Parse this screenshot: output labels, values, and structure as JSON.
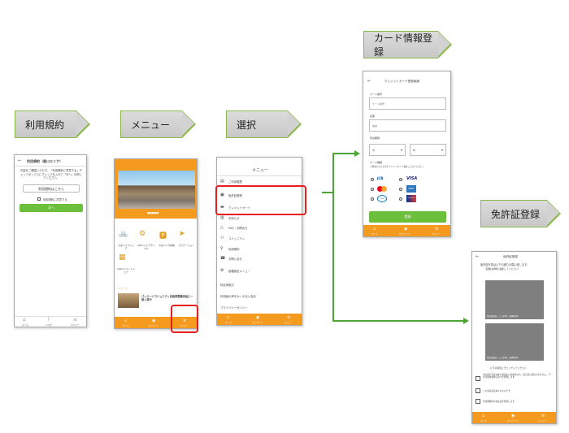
{
  "steps": {
    "terms": "利用規約",
    "menu": "メニュー",
    "select": "選択",
    "card": "カード情報登録",
    "license": "免許証登録"
  },
  "terms_screen": {
    "title": "利用規約（香川エリア）",
    "intro": "内容をご確認いただき、「利用規約に同意する」チェックボックスにチェックを入れて「次へ」を押してください。",
    "view_button": "利用規約はこちら",
    "agree_label": "利用規約に同意する",
    "next_button": "次へ",
    "nav": [
      "ホーム",
      "ヘルプ",
      "メニュー"
    ]
  },
  "menu_screen": {
    "slider_label": "■■■■■",
    "items": [
      "ちばバイクシェア",
      "OpEnシェアサイクル",
      "ちばバイク駐輪",
      "ナビゲーション",
      "OpEnイベントシェア"
    ],
    "news_header": "ニュース",
    "news_text": "パッケージコミュニティ自転車整備用品に一部入荷中",
    "nav": [
      "ホーム",
      "マイページ",
      "メニュー"
    ]
  },
  "select_screen": {
    "title": "メニュー",
    "items": [
      "ご利用履歴",
      "免許証登録",
      "クレジットカード",
      "お知らせ",
      "FAQ・お問合せ",
      "コミュニティ",
      "利用規約",
      "お問い合せ",
      "各種設定メニュー",
      "特定商取引",
      "利用者の声をかくれない会社",
      "プライバシーポリシー"
    ],
    "nav": [
      "ホーム",
      "マイページ",
      "メニュー"
    ]
  },
  "card_screen": {
    "title": "クレジットカード登録画面",
    "card_number_label": "カード番号",
    "card_number_placeholder": "カード番号",
    "name_label": "名義",
    "name_value": "なお",
    "expiry_label": "有効期限",
    "month": "月",
    "year": "年",
    "brands_label": "カード種類",
    "brands_note": "ご利用いただけるクレジットカード会社ご入力ください。",
    "brands": [
      "JCB",
      "VISA",
      "Mastercard",
      "AMEX",
      "Diners",
      "Discover"
    ],
    "submit": "登録",
    "nav": [
      "ホーム",
      "マイページ",
      "メニュー"
    ]
  },
  "license_screen": {
    "title": "免許証登録",
    "instruction": "免許証写真は以下の通りお願い致します。",
    "sub_instruction": "（画像は鮮明に撮影してください）",
    "front_caption": "免許証表面（ここを押して画像添付）",
    "back_caption": "免許証裏面（ここを押して画像添付）",
    "notice": "以下の項目にチェックしてください",
    "checks": [
      "免許証の写真は本人確認のため使用され、第三者に提供されません。データは利用規約に基づき管理します。",
      "この免許証は本人のものです",
      "有効期限内の免許証を登録します"
    ],
    "nav": [
      "ホーム",
      "マイページ",
      "メニュー"
    ]
  }
}
